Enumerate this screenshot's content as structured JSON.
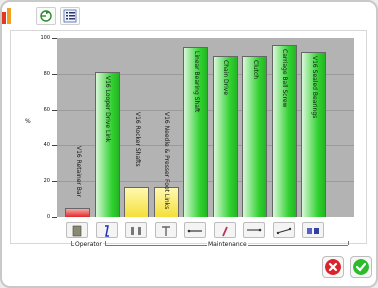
{
  "toolbar": {
    "icons": [
      "app-logo-icon",
      "refresh-icon",
      "list-icon"
    ]
  },
  "chart_data": {
    "type": "bar",
    "ylabel": "%",
    "ylim": [
      0,
      100
    ],
    "yticks": [
      "0",
      "20",
      "40",
      "60",
      "80",
      "100"
    ],
    "categories": [
      "V16 Retainer Bar",
      "V16 Looper Drive Link",
      "V16 Rocker Shafts",
      "V16 Needle & Presser Foot Links",
      "Linear Bearing Shaft",
      "Chain Drive",
      "Clutch",
      "Carriage Ball Screw",
      "V16 Sealed Bearings"
    ],
    "values": [
      5,
      81,
      17,
      17,
      95,
      90,
      90,
      96,
      92
    ],
    "colors": [
      "#e02828",
      "#2fd12f",
      "#f4df3a",
      "#f4df3a",
      "#2fd12f",
      "#2fd12f",
      "#2fd12f",
      "#2fd12f",
      "#2fd12f"
    ],
    "groups": [
      {
        "label": "Operator"
      },
      {
        "label": "Maintenance"
      }
    ]
  },
  "actions": {
    "cancel_color": "#d9242b",
    "ok_color": "#2bbb2b"
  }
}
